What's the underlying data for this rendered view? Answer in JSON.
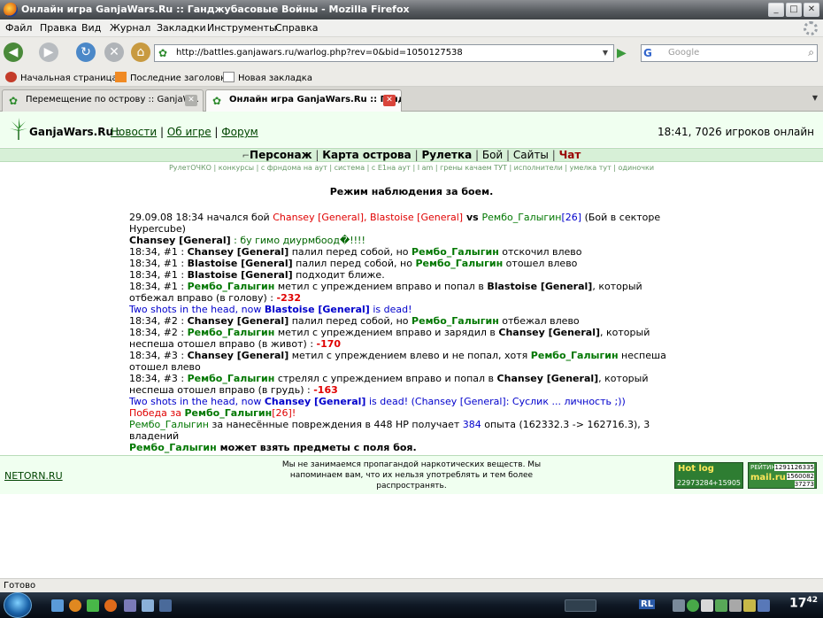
{
  "window": {
    "title": "Онлайн игра GanjaWars.Ru :: Ганджубасовые Войны - Mozilla Firefox",
    "buttons": [
      "_",
      "□",
      "✕"
    ]
  },
  "menu": [
    "Файл",
    "Правка",
    "Вид",
    "Журнал",
    "Закладки",
    "Инструменты",
    "Справка"
  ],
  "toolbar": {
    "url": "http://battles.ganjawars.ru/warlog.php?rev=0&bid=1050127538",
    "search_engine": "G",
    "search_placeholder": "Google"
  },
  "bookmarks": [
    "Начальная страница",
    "Последние заголовки",
    "Новая закладка"
  ],
  "tabs": [
    {
      "label": "Перемещение по острову :: GanjaW...",
      "active": false
    },
    {
      "label": "Онлайн игра GanjaWars.Ru :: Ганд...",
      "active": true
    }
  ],
  "site": {
    "name": "GanjaWars.Ru",
    "colon": " :",
    "links": [
      "Новости",
      "Об игре",
      "Форум"
    ],
    "sep": " | ",
    "time_online": "18:41, 7026 игроков онлайн"
  },
  "mainnav": {
    "items": [
      "Персонаж",
      "Карта острова",
      "Рулетка",
      "Бой",
      "Сайты",
      "Чат"
    ],
    "sep": " | "
  },
  "subnav": "РулетОЧКО | конкурсы | с фрндома на аут | система | с Е1на аут | I am | грены качаем ТУТ | исполнители | умелка тут | одиночки",
  "mode_title": "Режим наблюдения за боем.",
  "log": {
    "l1": {
      "a": "29.09.08 18:34 начался бой ",
      "b": "Chansey [General], Blastoise [General]",
      "c": " vs ",
      "d": "Рембо_Галыгин",
      "e": "[26]",
      "f": " (Бой в секторе Hypercube)"
    },
    "l2": {
      "a": "Chansey [General]",
      "b": " : бу гимо диурмбоод�!!!!"
    },
    "l3": {
      "a": "18:34, #1 : ",
      "b": "Chansey [General]",
      "c": " палил перед собой, но ",
      "d": "Рембо_Галыгин",
      "e": " отскочил влево"
    },
    "l4": {
      "a": "18:34, #1 : ",
      "b": "Blastoise [General]",
      "c": " палил перед собой, но ",
      "d": "Рембо_Галыгин",
      "e": " отошел влево"
    },
    "l5": {
      "a": "18:34, #1 : ",
      "b": "Blastoise [General]",
      "c": " подходит ближе."
    },
    "l6": {
      "a": "18:34, #1 : ",
      "b": "Рембо_Галыгин",
      "c": " метил с упреждением вправо и попал в ",
      "d": "Blastoise [General]",
      "e": ", который отбежал вправо (в голову) : ",
      "f": "-232"
    },
    "l7": {
      "a": "Two shots in the head, now ",
      "b": "Blastoise [General]",
      "c": " is dead!"
    },
    "l8": {
      "a": "18:34, #2 : ",
      "b": "Chansey [General]",
      "c": " палил перед собой, но ",
      "d": "Рембо_Галыгин",
      "e": " отбежал влево"
    },
    "l9": {
      "a": "18:34, #2 : ",
      "b": "Рембо_Галыгин",
      "c": " метил с упреждением вправо и зарядил в ",
      "d": "Chansey [General]",
      "e": ", который неспеша отошел вправо (в живот) : ",
      "f": "-170"
    },
    "l10": {
      "a": "18:34, #3 : ",
      "b": "Chansey [General]",
      "c": " метил с упреждением влево и не попал, хотя ",
      "d": "Рембо_Галыгин",
      "e": " неспеша отошел влево"
    },
    "l11": {
      "a": "18:34, #3 : ",
      "b": "Рембо_Галыгин",
      "c": " стрелял с упреждением вправо и попал в ",
      "d": "Chansey [General]",
      "e": ", который неспеша отошел вправо (в грудь) : ",
      "f": "-163"
    },
    "l12": {
      "a": "Two shots in the head, now ",
      "b": "Chansey [General]",
      "c": " is dead! (Chansey [General]: Суслик ... личность ;))"
    },
    "l13": {
      "a": "Победа за ",
      "b": "Рембо_Галыгин",
      "c": "[26]",
      "d": "!"
    },
    "l14": {
      "a": "Рембо_Галыгин",
      "b": " за нанесённые повреждения в 448 HP получает ",
      "c": "384",
      "d": " опыта (162332.3 -> 162716.3), 3 владений"
    },
    "l15": {
      "a": "Рембо_Галыгин",
      "b": " может взять предметы с поля боя."
    }
  },
  "footer": {
    "netorn": "NETORN.RU",
    "disclaimer": "Мы не занимаемся пропагандой наркотических веществ. Мы напоминаем вам, что их нельзя употреблять и тем более распространять.",
    "counter1": {
      "brand": "Hot log",
      "a": "22973284",
      "b": "+15905"
    },
    "counter2": {
      "brand": "mail.ru",
      "label": "РЕЙТИНГ",
      "a": "1291126335",
      "b": "1560082",
      "c": "37273"
    }
  },
  "status": "Готово",
  "taskbar": {
    "lang": "RL",
    "clock_h": "17",
    "clock_m": "42"
  },
  "colors": {
    "site_bg": "#f0fff0",
    "nav_bg": "#d7f0d7",
    "hero": "#007700",
    "enemy": "#e00000",
    "damage": "#e00000",
    "system_blue": "#0000cc"
  }
}
